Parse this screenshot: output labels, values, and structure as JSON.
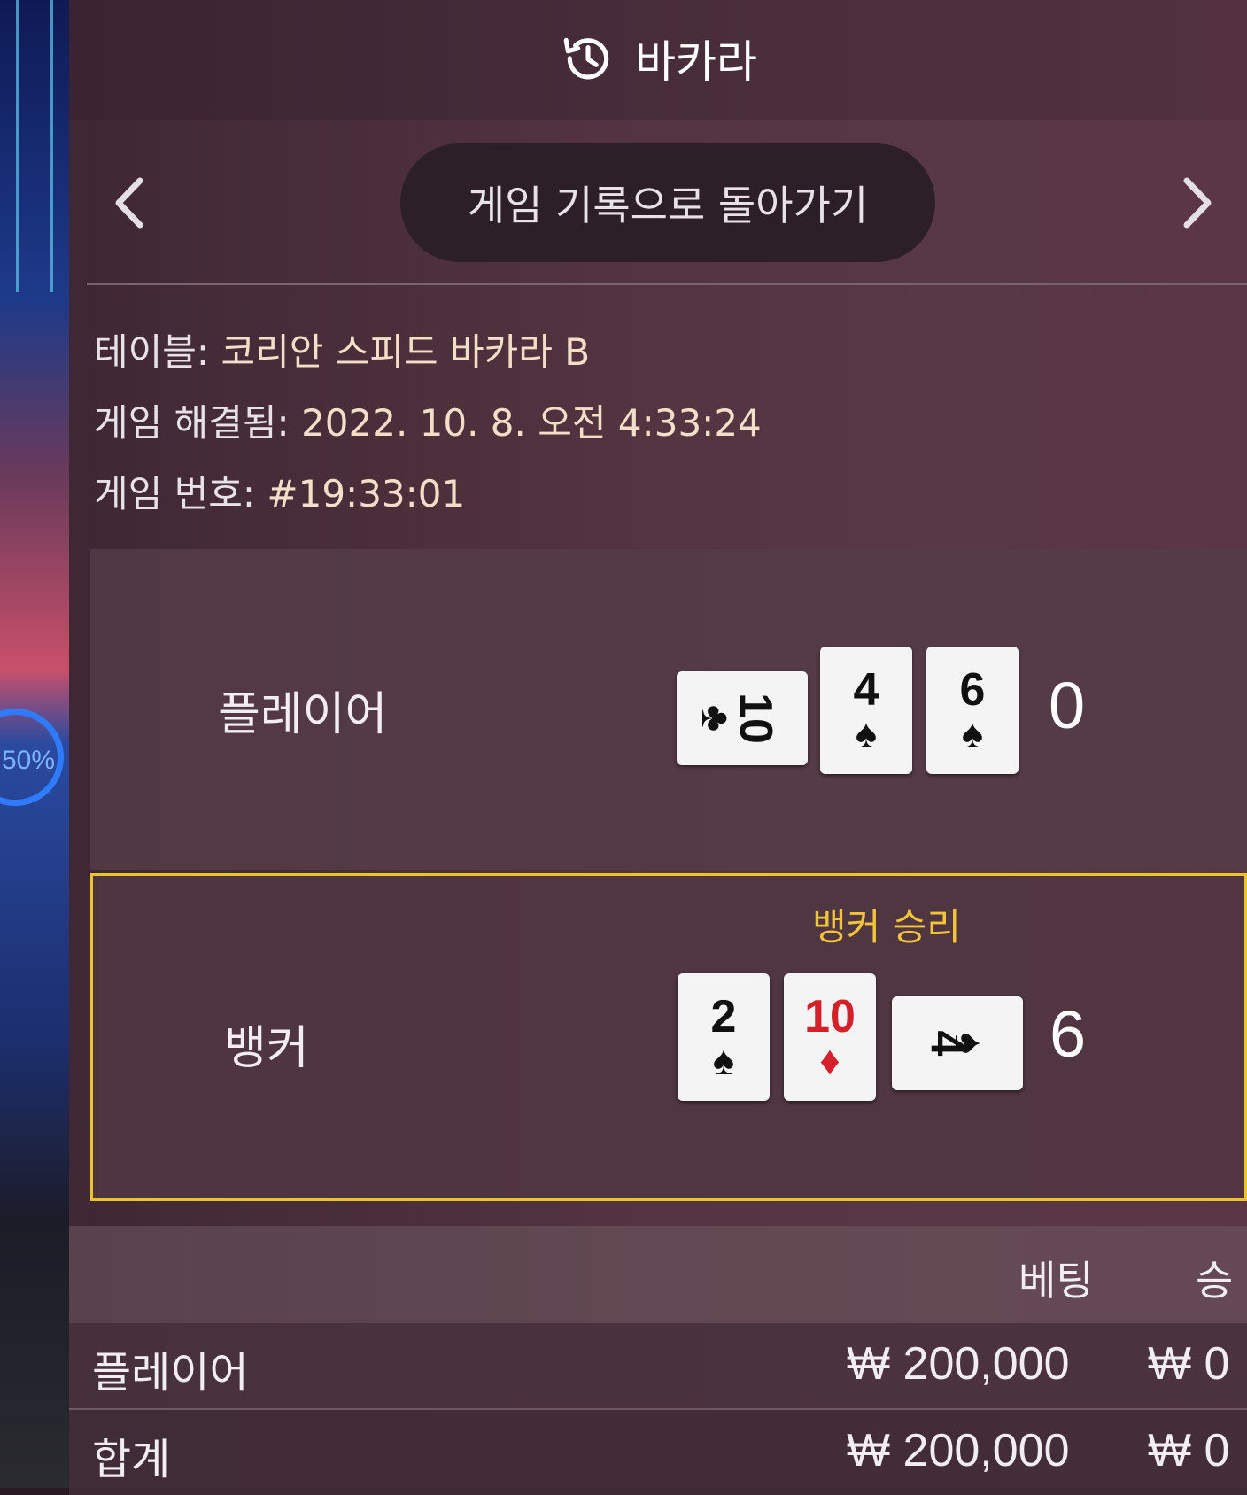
{
  "background": {
    "percent_text": "50%"
  },
  "header": {
    "title": "바카라",
    "history_icon": "history-icon"
  },
  "nav": {
    "back_label": "게임 기록으로 돌아가기",
    "prev_icon": "chevron-left-icon",
    "next_icon": "chevron-right-icon"
  },
  "info": {
    "table_label": "테이블:",
    "table_value": "코리안 스피드 바카라 B",
    "resolved_label": "게임 해결됨:",
    "resolved_value": "2022. 10. 8. 오전 4:33:24",
    "number_label": "게임 번호:",
    "number_value": "#19:33:01"
  },
  "hands": {
    "player": {
      "label": "플레이어",
      "score": "0",
      "cards": [
        {
          "rank": "10",
          "suit": "♣",
          "color": "black",
          "orientation": "sideways"
        },
        {
          "rank": "4",
          "suit": "♠",
          "color": "black",
          "orientation": "upright"
        },
        {
          "rank": "6",
          "suit": "♠",
          "color": "black",
          "orientation": "upright"
        }
      ]
    },
    "banker": {
      "label": "뱅커",
      "win_text": "뱅커 승리",
      "score": "6",
      "highlight_color": "#e9c42a",
      "cards": [
        {
          "rank": "2",
          "suit": "♠",
          "color": "black",
          "orientation": "upright"
        },
        {
          "rank": "10",
          "suit": "♦",
          "color": "red",
          "orientation": "upright"
        },
        {
          "rank": "4",
          "suit": "♠",
          "color": "black",
          "orientation": "sideways"
        }
      ]
    }
  },
  "bets": {
    "columns": {
      "bet": "베팅",
      "win": "승"
    },
    "rows": [
      {
        "name": "플레이어",
        "bet": "₩ 200,000",
        "win": "₩ 0"
      },
      {
        "name": "합계",
        "bet": "₩ 200,000",
        "win": "₩ 0"
      }
    ]
  }
}
